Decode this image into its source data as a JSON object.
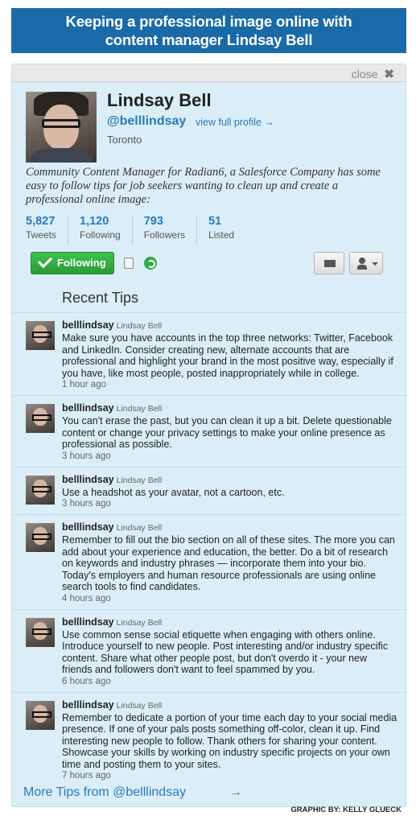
{
  "banner": {
    "line1": "Keeping a professional image online with",
    "line2": "content manager Lindsay Bell"
  },
  "close": {
    "label": "close",
    "icon": "✖"
  },
  "profile": {
    "name": "Lindsay Bell",
    "handle": "@belllindsay",
    "view_link": "view full profile →",
    "location": "Toronto",
    "bio": "Community Content Manager for Radian6, a Salesforce Company has some easy to follow tips for job seekers wanting to clean up and create a professional online image:"
  },
  "stats": [
    {
      "num": "5,827",
      "label": "Tweets"
    },
    {
      "num": "1,120",
      "label": "Following"
    },
    {
      "num": "793",
      "label": "Followers"
    },
    {
      "num": "51",
      "label": "Listed"
    }
  ],
  "actions": {
    "follow_label": "Following"
  },
  "section_title": "Recent Tips",
  "tips": [
    {
      "user": "belllindsay",
      "real": "Lindsay Bell",
      "text": "Make sure you have accounts in the top three networks: Twitter, Facebook and LinkedIn. Consider creating new, alternate accounts that are professional and highlight your brand in the most positive way, especially if you have, like most people, posted inappropriately while in college.",
      "time": "1 hour ago"
    },
    {
      "user": "belllindsay",
      "real": "Lindsay Bell",
      "text": "You can't erase the past, but you can clean it up a bit. Delete questionable content or change your privacy settings to make your online presence as professional as possible.",
      "time": "3 hours ago"
    },
    {
      "user": "belllindsay",
      "real": "Lindsay Bell",
      "text": "Use a headshot as your avatar, not a cartoon, etc.",
      "time": "3 hours ago"
    },
    {
      "user": "belllindsay",
      "real": "Lindsay Bell",
      "text": "Remember to fill out the bio section on all of these sites. The more you can add about your experience and education, the better. Do a bit of research on keywords and industry phrases — incorporate them into your bio. Today's employers and human resource professionals are using online search tools to find candidates.",
      "time": "4 hours ago"
    },
    {
      "user": "belllindsay",
      "real": "Lindsay Bell",
      "text": "Use common sense social etiquette when engaging with others online. Introduce yourself to new people. Post interesting and/or industry specific content. Share what other people post, but don't overdo it - your new friends and followers don't want to feel spammed by you.",
      "time": "6 hours ago"
    },
    {
      "user": "belllindsay",
      "real": "Lindsay Bell",
      "text": "Remember to dedicate a portion of your time each day to your social media presence. If one of your pals posts something off-color, clean it up. Find interesting new people to follow. Thank others for sharing your content. Showcase your skills by working on industry specific projects on your own time and posting them to your sites.",
      "time": "7 hours ago"
    }
  ],
  "more": {
    "label": "More Tips from @belllindsay",
    "arrow": "→"
  },
  "credit": "GRAPHIC BY: KELLY GLUECK"
}
